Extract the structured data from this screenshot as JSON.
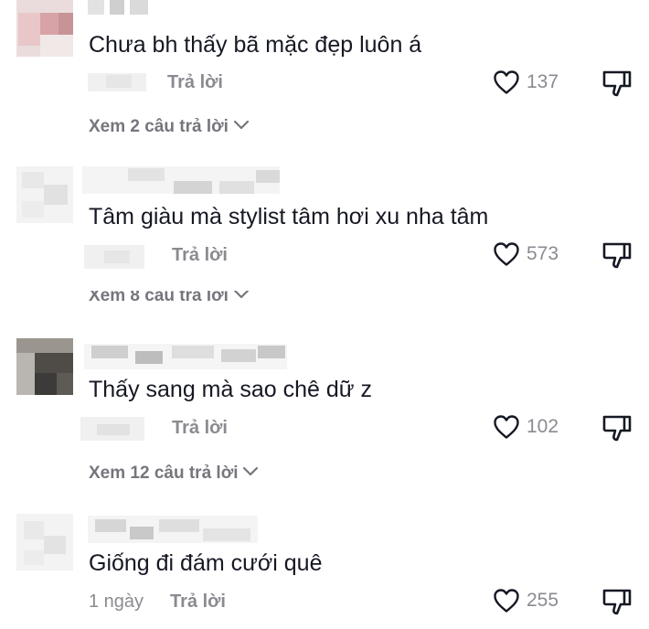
{
  "comments": [
    {
      "text": "Chưa bh thấy bã mặc đẹp luôn á",
      "time": "",
      "reply_label": "Trả lời",
      "likes": "137",
      "view_replies": "Xem 2 câu trả lời"
    },
    {
      "text": "Tâm giàu mà stylist tâm hơi xu nha tâm",
      "time": "",
      "reply_label": "Trả lời",
      "likes": "573",
      "view_replies": "Xem 8 câu trả lời"
    },
    {
      "text": "Thấy sang mà sao chê dữ z",
      "time": "",
      "reply_label": "Trả lời",
      "likes": "102",
      "view_replies": "Xem 12 câu trả lời"
    },
    {
      "text": "Giống đi đám cưới quê",
      "time": "1 ngày",
      "reply_label": "Trả lời",
      "likes": "255",
      "view_replies": ""
    }
  ],
  "icons": {
    "like": "heart-outline-icon",
    "dislike": "thumbs-down-outline-icon",
    "chevron": "chevron-down-icon"
  },
  "colors": {
    "text": "#161823",
    "muted": "#8a8b91",
    "icon": "#161823"
  }
}
